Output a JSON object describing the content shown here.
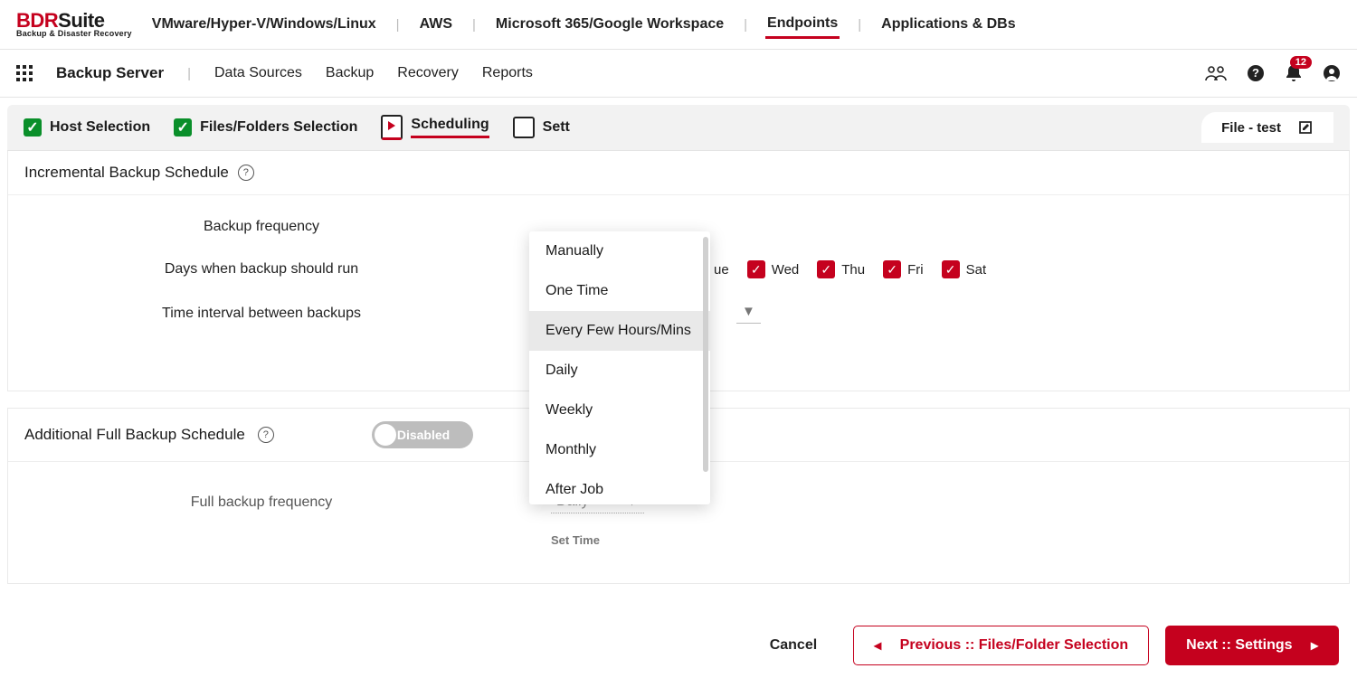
{
  "brand": {
    "name1": "BDR",
    "name2": "Suite",
    "sub": "Backup & Disaster Recovery"
  },
  "topnav": {
    "items": [
      "VMware/Hyper-V/Windows/Linux",
      "AWS",
      "Microsoft 365/Google Workspace",
      "Endpoints",
      "Applications & DBs"
    ],
    "active": 3
  },
  "subnav": {
    "main": "Backup Server",
    "items": [
      "Data Sources",
      "Backup",
      "Recovery",
      "Reports"
    ],
    "badge": "12"
  },
  "steps": [
    {
      "label": "Host Selection",
      "state": "done"
    },
    {
      "label": "Files/Folders Selection",
      "state": "done"
    },
    {
      "label": "Scheduling",
      "state": "current"
    },
    {
      "label": "Sett",
      "state": "todo"
    }
  ],
  "job": {
    "name": "File - test"
  },
  "incr": {
    "title": "Incremental Backup Schedule",
    "freq_label": "Backup frequency",
    "days_label": "Days when backup should run",
    "interval_label": "Time interval between backups",
    "days": [
      "ue",
      "Wed",
      "Thu",
      "Fri",
      "Sat"
    ]
  },
  "dropdown": {
    "options": [
      "Manually",
      "One Time",
      "Every Few Hours/Mins",
      "Daily",
      "Weekly",
      "Monthly",
      "After Job"
    ],
    "selected": 2
  },
  "full": {
    "title": "Additional Full Backup Schedule",
    "toggle": "Disabled",
    "freq_label": "Full backup frequency",
    "freq_value": "Daily",
    "settime": "Set Time"
  },
  "footer": {
    "cancel": "Cancel",
    "prev": "Previous :: Files/Folder Selection",
    "next": "Next :: Settings"
  }
}
